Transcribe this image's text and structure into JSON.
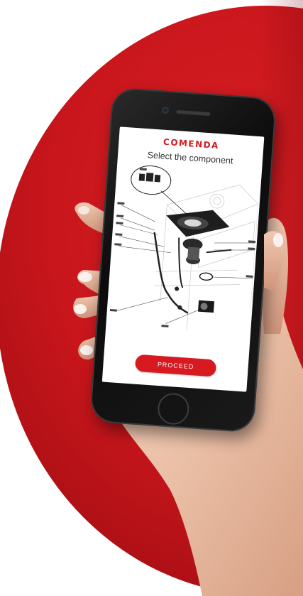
{
  "app": {
    "brand": "COMENDA",
    "screen_title": "Select the component",
    "proceed_label": "PROCEED"
  },
  "colors": {
    "brand_red": "#d71920",
    "background_red": "#c8161c",
    "screen_bg": "#ffffff"
  },
  "icons": {
    "diagram": "exploded-parts-diagram"
  }
}
